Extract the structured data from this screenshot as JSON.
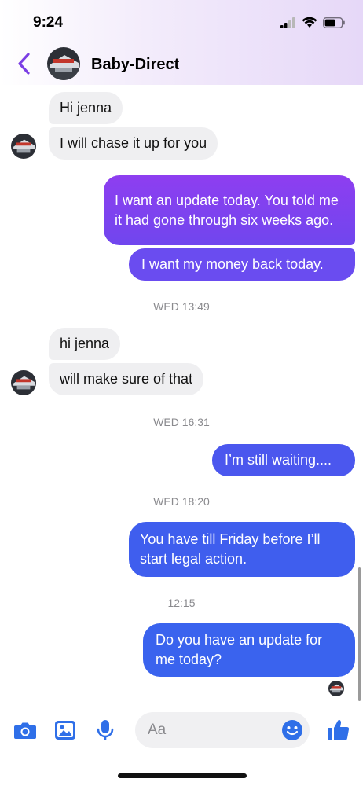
{
  "status_bar": {
    "time": "9:24"
  },
  "header": {
    "title": "Baby-Direct"
  },
  "messages": [
    {
      "text": "Hi jenna"
    },
    {
      "text": "I will chase it up for you"
    },
    {
      "text": "I want an update today. You told me it had gone through six weeks ago."
    },
    {
      "text": "I want my money back today."
    },
    {
      "timestamp": "WED 13:49"
    },
    {
      "text": "hi jenna"
    },
    {
      "text": "will make sure of that"
    },
    {
      "timestamp": "WED 16:31"
    },
    {
      "text": "I’m still waiting...."
    },
    {
      "timestamp": "WED 18:20"
    },
    {
      "text": "You have till Friday before I’ll start legal action."
    },
    {
      "timestamp": "12:15"
    },
    {
      "text": "Do you have an update for me today?"
    }
  ],
  "composer": {
    "placeholder": "Aa"
  },
  "colors": {
    "accent": "#7b3fe4",
    "bubble_purple_top": "#8b3ff0",
    "bubble_purple": "#6a4cf0",
    "bubble_blue": "#3a63ee",
    "bubble_in": "#efeff1"
  },
  "icons": [
    "back-chevron-icon",
    "camera-icon",
    "image-icon",
    "microphone-icon",
    "emoji-icon",
    "thumbs-up-icon"
  ]
}
